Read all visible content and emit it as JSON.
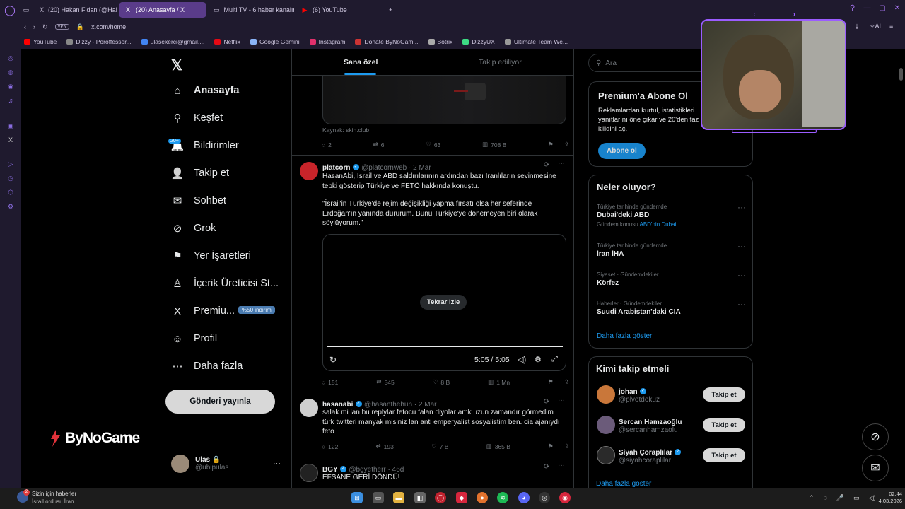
{
  "browser": {
    "tabs": [
      {
        "label": "(20) Hakan Fidan (@Hakan",
        "active": false
      },
      {
        "label": "(20) Anasayfa / X",
        "active": true
      },
      {
        "label": "Multi TV - 6 haber kanalın",
        "active": false
      },
      {
        "label": "(6) YouTube",
        "active": false
      }
    ],
    "url": "x.com/home",
    "vpn_label": "VPN",
    "ai_label": "AI",
    "bookmarks": [
      "YouTube",
      "Dizzy - Poroffessor...",
      "ulasekerci@gmail....",
      "Netflix",
      "Google Gemini",
      "Instagram",
      "Donate ByNoGam...",
      "Botrix",
      "DizzyUX",
      "Ultimate Team We..."
    ],
    "bookmark_colors": [
      "#ff0000",
      "#888888",
      "#4285f4",
      "#e50914",
      "#8ab4f8",
      "#e1306c",
      "#cc3333",
      "#aaaaaa",
      "#3ddc84",
      "#999999"
    ]
  },
  "nav": {
    "items": [
      {
        "label": "Anasayfa",
        "icon": "home-icon",
        "glyph": "⌂",
        "bold": true
      },
      {
        "label": "Keşfet",
        "icon": "search-icon",
        "glyph": "⚲"
      },
      {
        "label": "Bildirimler",
        "icon": "bell-icon",
        "glyph": "🔔"
      },
      {
        "label": "Takip et",
        "icon": "add-person-icon",
        "glyph": "👤"
      },
      {
        "label": "Sohbet",
        "icon": "mail-icon",
        "glyph": "✉"
      },
      {
        "label": "Grok",
        "icon": "grok-icon",
        "glyph": "⊘"
      },
      {
        "label": "Yer İşaretleri",
        "icon": "bookmark-icon",
        "glyph": "⚑"
      },
      {
        "label": "İçerik Üreticisi St...",
        "icon": "creator-icon",
        "glyph": "♙"
      },
      {
        "label": "Premiu...",
        "icon": "x-premium-icon",
        "glyph": "X"
      },
      {
        "label": "Profil",
        "icon": "profile-icon",
        "glyph": "☺"
      },
      {
        "label": "Daha fazla",
        "icon": "more-circle-icon",
        "glyph": "⋯"
      }
    ],
    "notif_badge": "20+",
    "premium_badge": "%50 indirim",
    "post_button": "Gönderi yayınla",
    "account_name": "Ulas",
    "account_handle": "@ubipulas",
    "brand_watermark": "ByNoGame"
  },
  "feed": {
    "tabs": [
      "Sana özel",
      "Takip ediliyor"
    ],
    "tweets": [
      {
        "source": "Kaynak: skin.club",
        "stats": [
          "2",
          "6",
          "63",
          "708 B"
        ]
      },
      {
        "name": "platcorn",
        "handle": "@platcornweb · 2 Mar",
        "text1": "HasanAbi, İsrail ve ABD saldırılarının ardından bazı İranlıların sevinmesine tepki gösterip Türkiye ve FETÖ hakkında konuştu.",
        "text2": "\"İsrail'in Türkiye'de rejim değişikliği yapma fırsatı olsa her seferinde Erdoğan'ın yanında dururum. Bunu Türkiye'ye dönemeyen biri olarak söylüyorum.\"",
        "replay": "Tekrar izle",
        "time": "5:05 / 5:05",
        "progress": 1.0,
        "stats": [
          "151",
          "545",
          "8 B",
          "1 Mn"
        ]
      },
      {
        "name": "hasanabi",
        "handle": "@hasanthehun · 2 Mar",
        "text1": "salak mi lan bu replylar fetocu falan diyolar amk uzun zamandır görmedim türk twitteri manyak misiniz lan anti emperyalist sosyalistim ben. cia ajanıydı feto",
        "stats": [
          "122",
          "193",
          "7 B",
          "365 B"
        ]
      },
      {
        "name": "BGY",
        "handle": "@bgyetherr · 46d",
        "text1": "EFSANE GERİ DÖNDÜ!"
      }
    ]
  },
  "right": {
    "search_placeholder": "Ara",
    "premium_title": "Premium'a Abone Ol",
    "premium_desc": "Reklamlardan kurtul, istatistikleri yanıtlarını öne çıkar ve 20'den faz kilidini aç.",
    "premium_btn": "Abone ol",
    "trends_title": "Neler oluyor?",
    "trends": [
      {
        "meta": "Türkiye tarihinde gündemde",
        "name": "Dubai'deki ABD",
        "sub_prefix": "Gündem konusu",
        "sub_link": "ABD'nin Dubai"
      },
      {
        "meta": "Türkiye tarihinde gündemde",
        "name": "İran İHA"
      },
      {
        "meta": "Siyaset · Gündemdekiler",
        "name": "Körfez"
      },
      {
        "meta": "Haberler · Gündemdekiler",
        "name": "Suudi Arabistan'daki CIA"
      }
    ],
    "trends_more": "Daha fazla göster",
    "who_title": "Kimi takip etmeli",
    "who": [
      {
        "name": "johan",
        "handle": "@plvotdokuz",
        "verified": true
      },
      {
        "name": "Sercan Hamzaoğlu",
        "handle": "@sercanhamzaolu",
        "verified": false
      },
      {
        "name": "Siyah Çoraplılar",
        "handle": "@siyahcoraplilar",
        "verified": true
      }
    ],
    "follow_label": "Takip et",
    "who_more": "Daha fazla göster"
  },
  "taskbar": {
    "news_title": "Sizin için haberler",
    "news_sub": "İsrail ordusu İran...",
    "news_badge": "2",
    "time": "02:44",
    "date": "4.03.2026"
  },
  "colors": {
    "accent": "#1d9bf0",
    "opera": "#5a3c8a",
    "webcam_border": "#9b5cff"
  }
}
